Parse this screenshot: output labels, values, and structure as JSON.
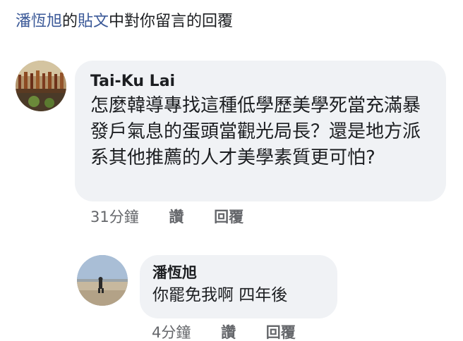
{
  "header": {
    "poster_name": "潘恆旭",
    "text_1": "的",
    "post_link": "貼文",
    "text_2": "中對你留言的回覆"
  },
  "comment": {
    "author": "Tai-Ku Lai",
    "text": "怎麼韓導專找這種低學歷美學死當充滿暴發戶氣息的蛋頭當觀光局長？還是地方派系其他推薦的人才美學素質更可怕?",
    "time": "31分鐘",
    "like_label": "讚",
    "reply_label": "回覆"
  },
  "reply": {
    "author": "潘恆旭",
    "text": "你罷免我啊 四年後",
    "time": "4分鐘",
    "like_label": "讚",
    "reply_label": "回覆"
  },
  "colors": {
    "link": "#3b5998",
    "bubble": "#f0f2f5",
    "meta": "#65676b"
  }
}
